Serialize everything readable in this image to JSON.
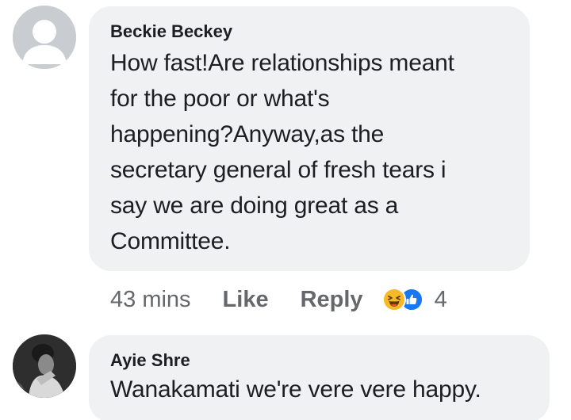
{
  "comments": [
    {
      "author": "Beckie Beckey",
      "lines": [
        "How fast!Are relationships meant",
        "for the poor or what's",
        "happening?Anyway,as the",
        "secretary general of fresh tears i",
        "say we are doing great as a",
        "Committee."
      ],
      "time": "43 mins",
      "like_label": "Like",
      "reply_label": "Reply",
      "reactions": [
        "haha",
        "like"
      ],
      "reaction_count": "4"
    },
    {
      "author": "Ayie Shre",
      "text": "Wanakamati we're vere vere happy."
    }
  ],
  "colors": {
    "bubble_bg": "#eff1f3",
    "meta_text": "#65676b",
    "haha": "#f7b928",
    "like": "#1877f2"
  }
}
